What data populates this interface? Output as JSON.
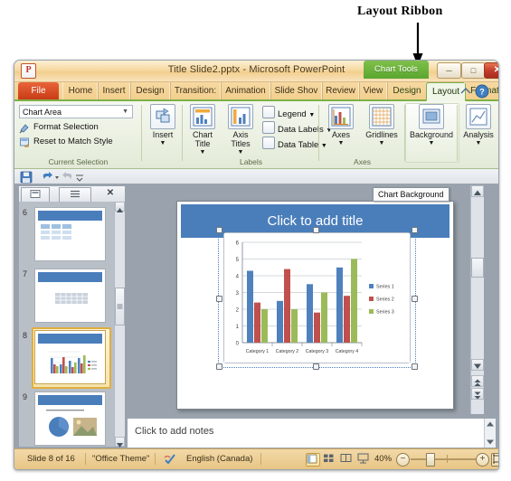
{
  "annotation": {
    "label": "Layout Ribbon"
  },
  "window": {
    "title": "Title Slide2.pptx  -  Microsoft PowerPoint",
    "app_icon": "powerpoint-logo-icon",
    "contextual_tab_group": "Chart Tools",
    "controls": {
      "minimize": "─",
      "maximize": "□",
      "close": "✕"
    }
  },
  "tabs": {
    "file": "File",
    "items": [
      {
        "label": "Home",
        "active": false
      },
      {
        "label": "Insert",
        "active": false
      },
      {
        "label": "Design",
        "active": false
      },
      {
        "label": "Transition:",
        "active": false
      },
      {
        "label": "Animation",
        "active": false
      },
      {
        "label": "Slide Shov",
        "active": false
      },
      {
        "label": "Review",
        "active": false
      },
      {
        "label": "View",
        "active": false
      },
      {
        "label": "Design",
        "active": false,
        "contextual": true
      },
      {
        "label": "Layout",
        "active": true,
        "contextual": true
      },
      {
        "label": "Format",
        "active": false,
        "contextual": true
      }
    ],
    "help_icons": [
      "minimize-ribbon-icon",
      "help-icon"
    ]
  },
  "ribbon": {
    "groups": [
      {
        "name": "Current Selection",
        "label": "Current Selection",
        "combo_value": "Chart Area",
        "commands": [
          {
            "label": "Format Selection",
            "icon": "format-selection-icon"
          },
          {
            "label": "Reset to Match Style",
            "icon": "reset-style-icon"
          }
        ]
      },
      {
        "name": "Insert",
        "label": "",
        "commands": [
          {
            "label": "Insert",
            "icon": "insert-shapes-icon",
            "dropdown": true
          }
        ]
      },
      {
        "name": "Labels",
        "label": "Labels",
        "big_commands": [
          {
            "label": "Chart Title",
            "icon": "chart-title-icon",
            "dropdown": true
          },
          {
            "label": "Axis Titles",
            "icon": "axis-titles-icon",
            "dropdown": true
          }
        ],
        "small_commands": [
          {
            "label": "Legend",
            "icon": "legend-icon",
            "dropdown": true
          },
          {
            "label": "Data Labels",
            "icon": "data-labels-icon",
            "dropdown": true
          },
          {
            "label": "Data Table",
            "icon": "data-table-icon",
            "dropdown": true
          }
        ]
      },
      {
        "name": "Axes",
        "label": "Axes",
        "big_commands": [
          {
            "label": "Axes",
            "icon": "axes-icon",
            "dropdown": true
          },
          {
            "label": "Gridlines",
            "icon": "gridlines-icon",
            "dropdown": true
          }
        ]
      },
      {
        "name": "Background",
        "label": "",
        "big_commands": [
          {
            "label": "Background",
            "icon": "background-icon",
            "dropdown": true
          }
        ]
      },
      {
        "name": "Analysis",
        "label": "",
        "big_commands": [
          {
            "label": "Analysis",
            "icon": "analysis-icon",
            "dropdown": true
          }
        ]
      }
    ]
  },
  "quick_access": {
    "items": [
      "save-icon",
      "undo-icon",
      "redo-icon",
      "customize-qat-icon"
    ]
  },
  "left_pane": {
    "tabs": [
      {
        "name": "slides-tab",
        "icon": "slides-tab-icon"
      },
      {
        "name": "outline-tab",
        "icon": "outline-tab-icon"
      }
    ],
    "close_icon": "✕",
    "thumbnails": [
      {
        "number": "6",
        "selected": false,
        "content": "table-grid"
      },
      {
        "number": "7",
        "selected": false,
        "content": "table-grid-small"
      },
      {
        "number": "8",
        "selected": true,
        "content": "bar-chart"
      },
      {
        "number": "9",
        "selected": false,
        "content": "pie-and-picture"
      }
    ]
  },
  "slide": {
    "tooltip": "Chart Background",
    "title_placeholder": "Click to add title",
    "notes_placeholder": "Click to add notes"
  },
  "chart_data": {
    "type": "bar",
    "title": "",
    "categories": [
      "Category 1",
      "Category 2",
      "Category 3",
      "Category 4"
    ],
    "series": [
      {
        "name": "Series 1",
        "color": "#4f81bd",
        "values": [
          4.3,
          2.5,
          3.5,
          4.5
        ]
      },
      {
        "name": "Series 2",
        "color": "#c0504d",
        "values": [
          2.4,
          4.4,
          1.8,
          2.8
        ]
      },
      {
        "name": "Series 3",
        "color": "#9bbb59",
        "values": [
          2.0,
          2.0,
          3.0,
          5.0
        ]
      }
    ],
    "ylim": [
      0,
      6
    ],
    "yticks": [
      "0",
      "1",
      "2",
      "3",
      "4",
      "5",
      "6"
    ],
    "xlabel": "",
    "ylabel": "",
    "grid": true,
    "legend_position": "right"
  },
  "status_bar": {
    "slide_counter": "Slide 8 of 16",
    "theme": "\"Office Theme\"",
    "spellcheck_icon": "spellcheck-icon",
    "language": "English (Canada)",
    "view_buttons": [
      {
        "name": "normal-view",
        "icon": "normal-view-icon",
        "active": true
      },
      {
        "name": "slide-sorter-view",
        "icon": "slide-sorter-icon",
        "active": false
      },
      {
        "name": "reading-view",
        "icon": "reading-view-icon",
        "active": false
      },
      {
        "name": "slide-show-view",
        "icon": "slide-show-icon",
        "active": false
      }
    ],
    "zoom_level": "40%",
    "zoom_out": "−",
    "zoom_in": "+",
    "fit_to_window_icon": "fit-slide-icon"
  }
}
